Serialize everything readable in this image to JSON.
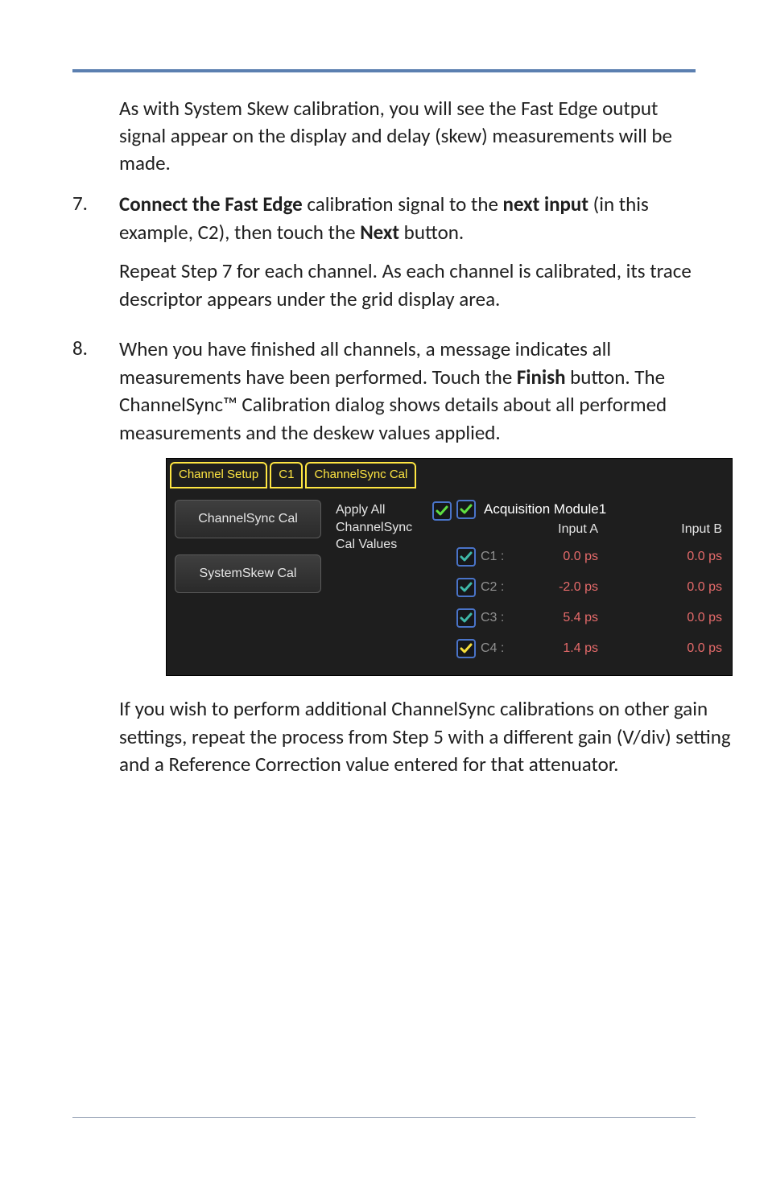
{
  "intro_para": "As with System Skew calibration, you will see the Fast Edge output signal appear on the display and delay (skew) measurements will be made.",
  "step7": {
    "num": "7.",
    "p1": {
      "t1": "Connect the Fast Edge",
      "t2": " calibration signal to the ",
      "t3": "next input",
      "t4": " (in this example, C2), then touch the ",
      "t5": "Next",
      "t6": " button."
    },
    "p2": "Repeat Step 7 for each channel. As each channel is calibrated, its trace descriptor appears under the grid display area."
  },
  "step8": {
    "num": "8.",
    "p1": {
      "t1": "When you have finished all channels, a message indicates all measurements have been performed. Touch the ",
      "t2": "Finish",
      "t3": " button. The ChannelSync™ Calibration dialog shows details about all performed measurements and the deskew values applied."
    }
  },
  "dialog": {
    "tabs": {
      "t1": "Channel Setup",
      "t2": "C1",
      "t3": "ChannelSync Cal"
    },
    "left": {
      "b1": "ChannelSync Cal",
      "b2": "SystemSkew Cal"
    },
    "mid_label": "Apply All ChannelSync Cal Values",
    "right": {
      "module": "Acquisition Module1",
      "colA": "Input A",
      "colB": "Input B",
      "rows": [
        {
          "ch": "C1 :",
          "a": "0.0 ps",
          "b": "0.0 ps"
        },
        {
          "ch": "C2 :",
          "a": "-2.0 ps",
          "b": "0.0 ps"
        },
        {
          "ch": "C3 :",
          "a": "5.4 ps",
          "b": "0.0 ps"
        },
        {
          "ch": "C4 :",
          "a": "1.4 ps",
          "b": "0.0 ps"
        }
      ]
    }
  },
  "final_para": "If you wish to perform additional ChannelSync calibrations on other gain settings, repeat the process from Step 5 with a different gain (V/div) setting and a Reference Correction value entered for that attenuator.",
  "chart_data": {
    "type": "table",
    "title": "Acquisition Module1",
    "columns": [
      "Channel",
      "Input A",
      "Input B"
    ],
    "rows": [
      [
        "C1",
        "0.0 ps",
        "0.0 ps"
      ],
      [
        "C2",
        "-2.0 ps",
        "0.0 ps"
      ],
      [
        "C3",
        "5.4 ps",
        "0.0 ps"
      ],
      [
        "C4",
        "1.4 ps",
        "0.0 ps"
      ]
    ]
  }
}
